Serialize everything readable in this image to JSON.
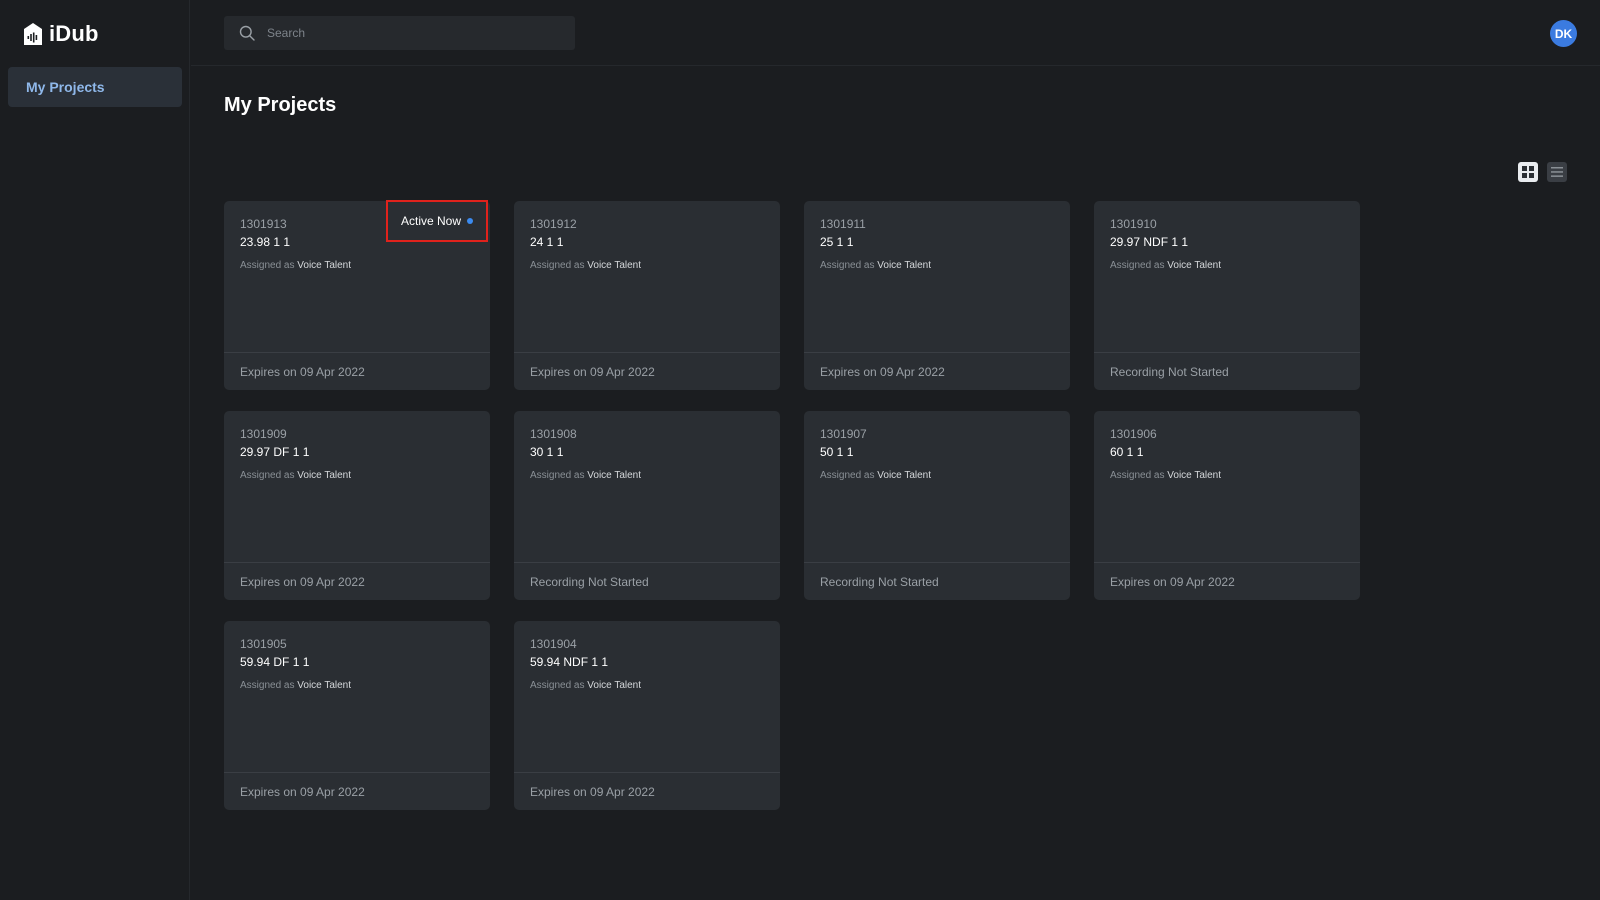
{
  "app": {
    "name": "iDub"
  },
  "sidebar": {
    "items": [
      {
        "label": "My Projects",
        "active": true
      }
    ]
  },
  "header": {
    "search": {
      "placeholder": "Search",
      "value": ""
    },
    "avatar_initials": "DK"
  },
  "main": {
    "title": "My Projects",
    "view_mode": "grid",
    "view_toggle": [
      {
        "icon": "grid-view-icon",
        "active": true
      },
      {
        "icon": "list-view-icon",
        "active": false
      }
    ]
  },
  "colors": {
    "accent": "#3b7be0",
    "active_dot": "#3b8bf0",
    "highlight_box": "#e0221c",
    "card_bg": "#2a2e33",
    "page_bg": "#1b1d20"
  },
  "projects": [
    {
      "id": "1301913",
      "name": "23.98 1 1",
      "assigned_prefix": "Assigned as",
      "role": "Voice Talent",
      "footer": "Expires on 09 Apr 2022",
      "badge": "Active Now"
    },
    {
      "id": "1301912",
      "name": "24 1 1",
      "assigned_prefix": "Assigned as",
      "role": "Voice Talent",
      "footer": "Expires on 09 Apr 2022"
    },
    {
      "id": "1301911",
      "name": "25 1 1",
      "assigned_prefix": "Assigned as",
      "role": "Voice Talent",
      "footer": "Expires on 09 Apr 2022"
    },
    {
      "id": "1301910",
      "name": "29.97 NDF 1 1",
      "assigned_prefix": "Assigned as",
      "role": "Voice Talent",
      "footer": "Recording Not Started"
    },
    {
      "id": "1301909",
      "name": "29.97 DF 1 1",
      "assigned_prefix": "Assigned as",
      "role": "Voice Talent",
      "footer": "Expires on 09 Apr 2022"
    },
    {
      "id": "1301908",
      "name": "30 1 1",
      "assigned_prefix": "Assigned as",
      "role": "Voice Talent",
      "footer": "Recording Not Started"
    },
    {
      "id": "1301907",
      "name": "50 1 1",
      "assigned_prefix": "Assigned as",
      "role": "Voice Talent",
      "footer": "Recording Not Started"
    },
    {
      "id": "1301906",
      "name": "60 1 1",
      "assigned_prefix": "Assigned as",
      "role": "Voice Talent",
      "footer": "Expires on 09 Apr 2022"
    },
    {
      "id": "1301905",
      "name": "59.94 DF 1 1",
      "assigned_prefix": "Assigned as",
      "role": "Voice Talent",
      "footer": "Expires on 09 Apr 2022"
    },
    {
      "id": "1301904",
      "name": "59.94 NDF 1 1",
      "assigned_prefix": "Assigned as",
      "role": "Voice Talent",
      "footer": "Expires on 09 Apr 2022"
    }
  ]
}
